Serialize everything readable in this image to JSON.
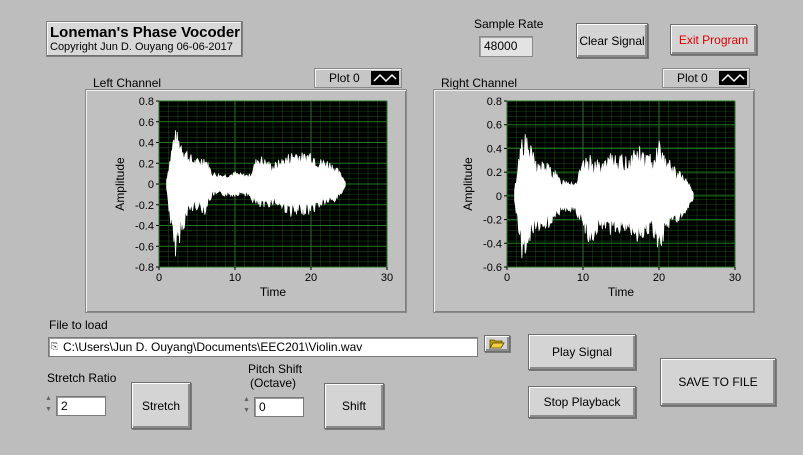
{
  "app": {
    "title": "Loneman's Phase Vocoder",
    "copyright": "Copyright Jun D. Ouyang 06-06-2017"
  },
  "sample_rate": {
    "label": "Sample Rate",
    "value": "48000"
  },
  "buttons": {
    "clear_signal": "Clear Signal",
    "exit_program": "Exit Program",
    "play_signal": "Play Signal",
    "stop_playback": "Stop Playback",
    "save_to_file": "SAVE TO FILE",
    "stretch": "Stretch",
    "shift": "Shift"
  },
  "colors": {
    "exit_text": "#e00000",
    "plot_bg": "#000000",
    "grid": "#1f7a1f",
    "signal": "#ffffff"
  },
  "left_graph": {
    "label": "Left Channel",
    "legend": "Plot 0",
    "ylabel": "Amplitude",
    "xlabel": "Time",
    "yticks": [
      "0.8",
      "0.6",
      "0.4",
      "0.2",
      "0",
      "-0.2",
      "-0.4",
      "-0.6",
      "-0.8"
    ],
    "xticks": [
      "0",
      "10",
      "20",
      "30"
    ]
  },
  "right_graph": {
    "label": "Right Channel",
    "legend": "Plot 0",
    "ylabel": "Amplitude",
    "xlabel": "Time",
    "yticks": [
      "0.8",
      "0.6",
      "0.4",
      "0.2",
      "0",
      "-0.2",
      "-0.4",
      "-0.6"
    ],
    "xticks": [
      "0",
      "10",
      "20",
      "30"
    ]
  },
  "file": {
    "label": "File to load",
    "path": "C:\\Users\\Jun D. Ouyang\\Documents\\EEC201\\Violin.wav",
    "path_icon": "path-prefix-icon",
    "browse_icon": "folder-open-icon"
  },
  "stretch": {
    "label": "Stretch Ratio",
    "value": "2"
  },
  "pitch": {
    "label_line1": "Pitch Shift",
    "label_line2": "(Octave)",
    "value": "0"
  },
  "chart_data": [
    {
      "type": "area",
      "title": "Left Channel",
      "xlabel": "Time",
      "ylabel": "Amplitude",
      "xlim": [
        0,
        30
      ],
      "ylim": [
        -0.8,
        0.8
      ],
      "grid": true,
      "legend": [
        "Plot 0"
      ],
      "series": [
        {
          "name": "Plot 0",
          "x": [
            1,
            2,
            3,
            4,
            5,
            6,
            7,
            8,
            9,
            10,
            11,
            12,
            13,
            14,
            15,
            16,
            17,
            18,
            19,
            20,
            21,
            22,
            23,
            24,
            24.5
          ],
          "upper": [
            0.05,
            0.55,
            0.45,
            0.3,
            0.25,
            0.3,
            0.12,
            0.1,
            0.1,
            0.12,
            0.1,
            0.1,
            0.3,
            0.25,
            0.2,
            0.25,
            0.3,
            0.35,
            0.3,
            0.35,
            0.25,
            0.25,
            0.2,
            0.1,
            0.03
          ],
          "lower": [
            -0.05,
            -0.75,
            -0.5,
            -0.3,
            -0.25,
            -0.3,
            -0.12,
            -0.12,
            -0.12,
            -0.12,
            -0.1,
            -0.15,
            -0.25,
            -0.25,
            -0.2,
            -0.25,
            -0.3,
            -0.35,
            -0.3,
            -0.3,
            -0.25,
            -0.2,
            -0.2,
            -0.1,
            -0.03
          ]
        }
      ]
    },
    {
      "type": "area",
      "title": "Right Channel",
      "xlabel": "Time",
      "ylabel": "Amplitude",
      "xlim": [
        0,
        30
      ],
      "ylim": [
        -0.6,
        0.8
      ],
      "grid": true,
      "legend": [
        "Plot 0"
      ],
      "series": [
        {
          "name": "Plot 0",
          "x": [
            1,
            2,
            3,
            4,
            5,
            6,
            7,
            8,
            9,
            10,
            11,
            12,
            13,
            14,
            15,
            16,
            17,
            18,
            19,
            20,
            21,
            22,
            23,
            24,
            24.5
          ],
          "upper": [
            0.05,
            0.6,
            0.45,
            0.3,
            0.3,
            0.25,
            0.15,
            0.15,
            0.12,
            0.3,
            0.35,
            0.3,
            0.3,
            0.4,
            0.35,
            0.35,
            0.45,
            0.4,
            0.35,
            0.5,
            0.35,
            0.25,
            0.2,
            0.1,
            0.03
          ],
          "lower": [
            -0.05,
            -0.55,
            -0.45,
            -0.3,
            -0.3,
            -0.25,
            -0.15,
            -0.15,
            -0.15,
            -0.3,
            -0.45,
            -0.3,
            -0.3,
            -0.35,
            -0.3,
            -0.3,
            -0.4,
            -0.35,
            -0.3,
            -0.5,
            -0.3,
            -0.25,
            -0.2,
            -0.1,
            -0.03
          ]
        }
      ]
    }
  ]
}
